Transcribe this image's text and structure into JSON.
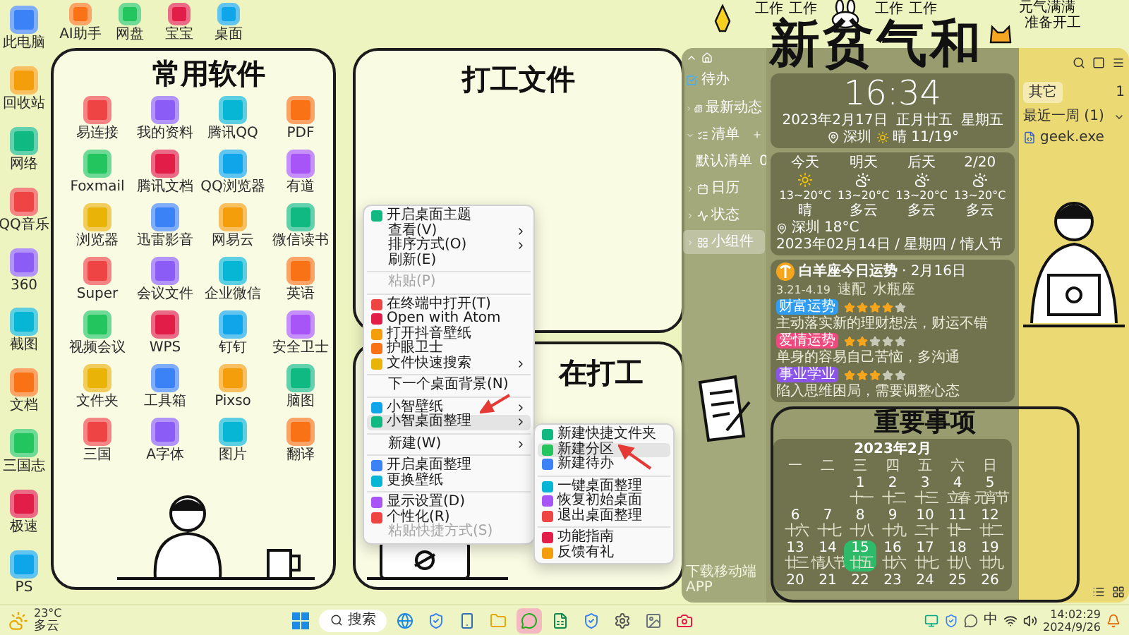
{
  "desktop": {
    "left_icons": [
      {
        "label": "此电脑"
      },
      {
        "label": "回收站"
      },
      {
        "label": "网络"
      },
      {
        "label": "QQ音乐"
      },
      {
        "label": "360"
      },
      {
        "label": "截图"
      },
      {
        "label": "文档"
      },
      {
        "label": "三国志"
      },
      {
        "label": "极速"
      },
      {
        "label": "PS"
      }
    ],
    "top_icons": [
      {
        "label": "AI助手"
      },
      {
        "label": "网盘"
      },
      {
        "label": "宝宝"
      },
      {
        "label": "桌面"
      }
    ]
  },
  "decor": {
    "work_labels": [
      "工作",
      "工作",
      "工作",
      "工作"
    ],
    "slogan": [
      "元气满满",
      "准备开工"
    ],
    "headline": "新贫气和"
  },
  "fences": [
    {
      "kind": "apps",
      "title": "常用软件",
      "icons": [
        {
          "label": "易连接"
        },
        {
          "label": "我的资料"
        },
        {
          "label": "腾讯QQ"
        },
        {
          "label": "PDF"
        },
        {
          "label": "Foxmail"
        },
        {
          "label": "腾讯文档"
        },
        {
          "label": "QQ浏览器"
        },
        {
          "label": "有道"
        },
        {
          "label": "浏览器"
        },
        {
          "label": "迅雷影音"
        },
        {
          "label": "网易云"
        },
        {
          "label": "微信读书"
        },
        {
          "label": "Super"
        },
        {
          "label": "会议文件"
        },
        {
          "label": "企业微信"
        },
        {
          "label": "英语"
        },
        {
          "label": "视频会议"
        },
        {
          "label": "WPS"
        },
        {
          "label": "钉钉"
        },
        {
          "label": "安全卫士"
        },
        {
          "label": "文件夹"
        },
        {
          "label": "工具箱"
        },
        {
          "label": "Pixso"
        },
        {
          "label": "脑图"
        },
        {
          "label": "三国"
        },
        {
          "label": "A字体"
        },
        {
          "label": "图片"
        },
        {
          "label": "翻译"
        }
      ]
    },
    {
      "kind": "empty",
      "title": "打工文件"
    },
    {
      "kind": "working",
      "title": "在打工"
    },
    {
      "kind": "notes",
      "title": "重要事项"
    }
  ],
  "widget_app": {
    "sidebar": {
      "title": "待办",
      "items": [
        {
          "label": "最新动态",
          "selected": false,
          "expanded": false
        },
        {
          "label": "清单",
          "selected": false,
          "expanded": true,
          "children": [
            {
              "label": "默认清单",
              "count": "0",
              "selected": false,
              "expanded": false
            }
          ]
        },
        {
          "label": "日历",
          "selected": false,
          "expanded": false
        },
        {
          "label": "状态",
          "selected": false,
          "expanded": false
        },
        {
          "label": "小组件",
          "selected": true,
          "expanded": false
        }
      ],
      "footer": "下载移动端APP"
    },
    "clock": {
      "time": "16:34",
      "date": "2023年2月17日",
      "lunar": "正月廿五",
      "weekday": "星期五",
      "city": "深圳",
      "weather": "晴 11/19°"
    },
    "weather": {
      "days": [
        {
          "day": "今天",
          "kind": "sunny",
          "temp": "13~20°C",
          "cond": "晴"
        },
        {
          "day": "明天",
          "kind": "cloudy",
          "temp": "13~20°C",
          "cond": "多云"
        },
        {
          "day": "后天",
          "kind": "cloudy",
          "temp": "13~20°C",
          "cond": "多云"
        },
        {
          "day": "2/20",
          "kind": "cloudy",
          "temp": "13~20°C",
          "cond": "多云"
        }
      ],
      "city": "深圳",
      "now": "18°C",
      "date_line": "2023年02月14日 / 星期四 / 情人节"
    },
    "horoscope": {
      "title": "白羊座今日运势",
      "date": "· 2月16日",
      "range": "3.21-4.19",
      "match_label": "速配",
      "match": "水瓶座",
      "aspects": [
        {
          "label": "财富运势",
          "color": "#2f9cf0",
          "stars": 4,
          "text": "主动落实新的理财想法，财运不错"
        },
        {
          "label": "爱情运势",
          "color": "#ef4a7d",
          "stars": 2,
          "text": "单身的容易自己苦恼，多沟通"
        },
        {
          "label": "事业学业",
          "color": "#8a55e8",
          "stars": 3,
          "text": "陷入思维困局，需要调整心态"
        }
      ]
    },
    "calendar": {
      "title": "2023年2月",
      "weekdays": [
        "一",
        "二",
        "三",
        "四",
        "五",
        "六",
        "日"
      ],
      "weeks": [
        [
          {
            "day": "1",
            "lunar": "十一",
            "selected": false
          },
          {
            "day": "2",
            "lunar": "十二",
            "selected": false
          },
          {
            "day": "3",
            "lunar": "十三",
            "selected": false
          },
          {
            "day": "4",
            "lunar": "立春",
            "selected": false
          },
          {
            "day": "5",
            "lunar": "元宵节",
            "selected": false
          }
        ],
        [
          {
            "day": "6",
            "lunar": "十六",
            "selected": false
          },
          {
            "day": "7",
            "lunar": "十七",
            "selected": false
          },
          {
            "day": "8",
            "lunar": "十八",
            "selected": false
          },
          {
            "day": "9",
            "lunar": "十九",
            "selected": false
          },
          {
            "day": "10",
            "lunar": "二十",
            "selected": false
          },
          {
            "day": "11",
            "lunar": "廿一",
            "selected": false
          },
          {
            "day": "12",
            "lunar": "廿二",
            "selected": false
          }
        ],
        [
          {
            "day": "13",
            "lunar": "廿三",
            "selected": false
          },
          {
            "day": "14",
            "lunar": "情人节",
            "selected": false
          },
          {
            "day": "15",
            "lunar": "廿五",
            "selected": true
          },
          {
            "day": "16",
            "lunar": "廿六",
            "selected": false
          },
          {
            "day": "17",
            "lunar": "廿七",
            "selected": false
          },
          {
            "day": "18",
            "lunar": "廿八",
            "selected": false
          },
          {
            "day": "19",
            "lunar": "廿九",
            "selected": false
          }
        ],
        [
          {
            "day": "20",
            "selected": false
          },
          {
            "day": "21",
            "selected": false
          },
          {
            "day": "22",
            "selected": false
          },
          {
            "day": "23",
            "selected": false
          },
          {
            "day": "24",
            "selected": false
          },
          {
            "day": "25",
            "selected": false
          },
          {
            "day": "26",
            "selected": false
          }
        ]
      ]
    },
    "side_panel": {
      "tab": "其它",
      "count": "1",
      "group": "最近一周 (1)",
      "files": [
        "geek.exe"
      ]
    }
  },
  "context_menu": {
    "groups": [
      [
        {
          "label": "开启桌面主题",
          "kind": "icon",
          "submenu": false,
          "disabled": false,
          "selected": false
        },
        {
          "label": "查看(V)",
          "kind": "plain",
          "submenu": true,
          "disabled": false,
          "selected": false
        },
        {
          "label": "排序方式(O)",
          "kind": "plain",
          "submenu": true,
          "disabled": false,
          "selected": false
        },
        {
          "label": "刷新(E)",
          "kind": "plain",
          "submenu": false,
          "disabled": false,
          "selected": false
        }
      ],
      [
        {
          "label": "粘贴(P)",
          "kind": "plain",
          "submenu": false,
          "disabled": true,
          "selected": false
        }
      ],
      [
        {
          "label": "在终端中打开(T)",
          "kind": "icon",
          "submenu": false,
          "disabled": false,
          "selected": false
        },
        {
          "label": "Open with Atom",
          "kind": "icon",
          "submenu": false,
          "disabled": false,
          "selected": false
        },
        {
          "label": "打开抖音壁纸",
          "kind": "icon",
          "submenu": false,
          "disabled": false,
          "selected": false
        },
        {
          "label": "护眼卫士",
          "kind": "icon",
          "submenu": false,
          "disabled": false,
          "selected": false
        },
        {
          "label": "文件快速搜索",
          "kind": "icon",
          "submenu": true,
          "disabled": false,
          "selected": false
        }
      ],
      [
        {
          "label": "下一个桌面背景(N)",
          "kind": "plain",
          "submenu": false,
          "disabled": false,
          "selected": false
        }
      ],
      [
        {
          "label": "小智壁纸",
          "kind": "icon",
          "submenu": true,
          "disabled": false,
          "selected": false
        },
        {
          "label": "小智桌面整理",
          "kind": "icon",
          "submenu": true,
          "disabled": false,
          "selected": true
        }
      ],
      [
        {
          "label": "新建(W)",
          "kind": "plain",
          "submenu": true,
          "disabled": false,
          "selected": false
        }
      ],
      [
        {
          "label": "开启桌面整理",
          "kind": "icon",
          "submenu": false,
          "disabled": false,
          "selected": false
        },
        {
          "label": "更换壁纸",
          "kind": "icon",
          "submenu": false,
          "disabled": false,
          "selected": false
        }
      ],
      [
        {
          "label": "显示设置(D)",
          "kind": "icon",
          "submenu": false,
          "disabled": false,
          "selected": false
        },
        {
          "label": "个性化(R)",
          "kind": "icon",
          "submenu": false,
          "disabled": false,
          "selected": false
        },
        {
          "label": "粘贴快捷方式(S)",
          "kind": "plain",
          "submenu": false,
          "disabled": true,
          "selected": false
        }
      ]
    ]
  },
  "submenu": {
    "groups": [
      [
        {
          "label": "新建快捷文件夹",
          "kind": "icon",
          "submenu": false,
          "disabled": false,
          "selected": false
        },
        {
          "label": "新建分区",
          "kind": "icon",
          "submenu": false,
          "disabled": false,
          "selected": true
        },
        {
          "label": "新建待办",
          "kind": "icon",
          "submenu": false,
          "disabled": false,
          "selected": false
        }
      ],
      [
        {
          "label": "一键桌面整理",
          "kind": "icon",
          "submenu": false,
          "disabled": false,
          "selected": false
        },
        {
          "label": "恢复初始桌面",
          "kind": "icon",
          "submenu": false,
          "disabled": false,
          "selected": false
        },
        {
          "label": "退出桌面整理",
          "kind": "icon",
          "submenu": false,
          "disabled": false,
          "selected": false
        }
      ],
      [
        {
          "label": "功能指南",
          "kind": "icon",
          "submenu": false,
          "disabled": false,
          "selected": false
        },
        {
          "label": "反馈有礼",
          "kind": "icon",
          "submenu": false,
          "disabled": false,
          "selected": false
        }
      ]
    ]
  },
  "taskbar": {
    "weather": {
      "temp": "23°C",
      "cond": "多云"
    },
    "search": {
      "label": "搜索"
    },
    "apps": [
      {
        "kind": "globe",
        "selected": false
      },
      {
        "kind": "shield",
        "selected": false
      },
      {
        "kind": "phone",
        "selected": false
      },
      {
        "kind": "folder",
        "selected": false
      },
      {
        "kind": "chat",
        "selected": true
      },
      {
        "kind": "sheet",
        "selected": false
      },
      {
        "kind": "shield",
        "selected": false
      },
      {
        "kind": "gear",
        "selected": false
      },
      {
        "kind": "image",
        "selected": false
      },
      {
        "kind": "camera",
        "selected": false
      }
    ],
    "ime": "中",
    "time": "14:02:29",
    "date": "2024/9/26"
  }
}
